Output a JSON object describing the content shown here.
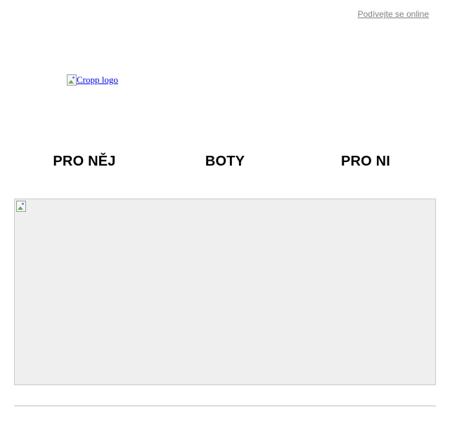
{
  "header": {
    "view_online_label": "Podívejte se online"
  },
  "logo": {
    "alt_text": "Cropp logo",
    "icon": "broken-image-icon"
  },
  "nav": {
    "items": [
      {
        "label": "PRO NĚJ"
      },
      {
        "label": "BOTY"
      },
      {
        "label": "PRO NI"
      }
    ]
  },
  "banner": {
    "icon": "broken-image-icon",
    "background_color": "#efefef"
  },
  "colors": {
    "link": "#0000ee",
    "muted_link": "#808080",
    "nav_text": "#000000",
    "divider": "#c0c0c0"
  }
}
